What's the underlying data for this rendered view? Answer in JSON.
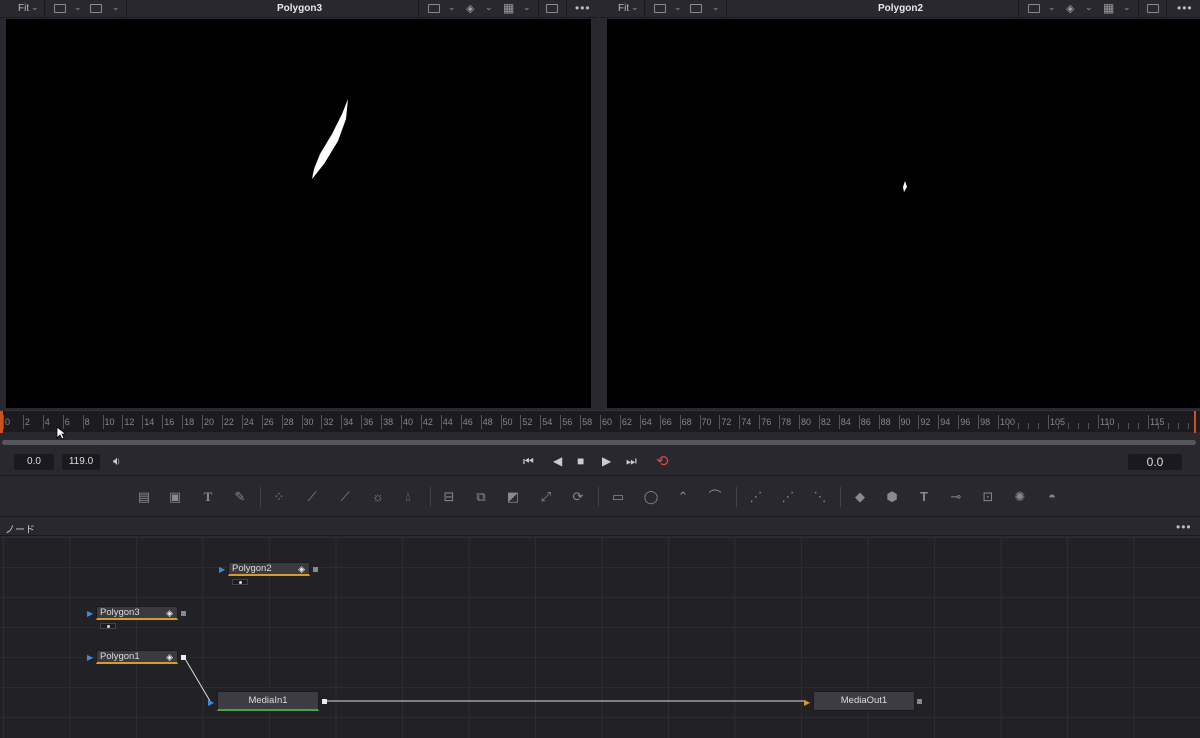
{
  "left_viewer": {
    "fit": "Fit",
    "title": "Polygon3"
  },
  "right_viewer": {
    "fit": "Fit",
    "title": "Polygon2"
  },
  "ruler": {
    "labels": [
      "0",
      "2",
      "4",
      "6",
      "8",
      "10",
      "12",
      "14",
      "16",
      "18",
      "20",
      "22",
      "24",
      "26",
      "28",
      "30",
      "32",
      "34",
      "36",
      "38",
      "40",
      "42",
      "44",
      "46",
      "48",
      "50",
      "52",
      "54",
      "56",
      "58",
      "60",
      "62",
      "64",
      "66",
      "68",
      "70",
      "72",
      "74",
      "76",
      "78",
      "80",
      "82",
      "84",
      "86",
      "88",
      "90",
      "92",
      "94",
      "96",
      "98",
      "100",
      "105",
      "110",
      "115"
    ]
  },
  "transport": {
    "start": "0.0",
    "end": "119.0",
    "current_time": "0.0"
  },
  "node_panel": {
    "label": "ノード",
    "nodes": {
      "polygon2": "Polygon2",
      "polygon3": "Polygon3",
      "polygon1": "Polygon1",
      "mediain": "MediaIn1",
      "mediaout": "MediaOut1"
    }
  },
  "colors": {
    "accent_orange": "#d79a2b",
    "media_green": "#47a347",
    "loop_red": "#e04a3a",
    "input_blue": "#3b8be0"
  }
}
